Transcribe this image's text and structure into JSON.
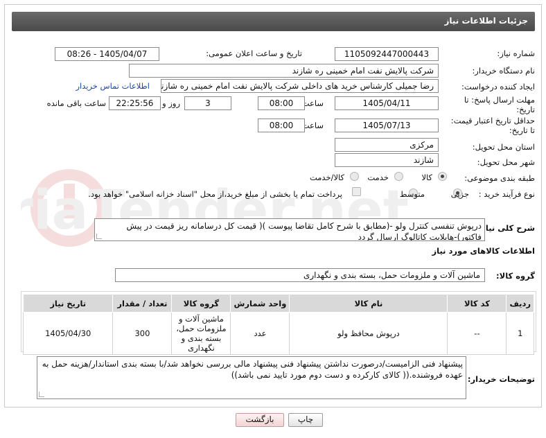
{
  "header": {
    "title": "جزئیات اطلاعات نیاز"
  },
  "watermark": {
    "text": "AriaTender.net"
  },
  "fields": {
    "need_number": {
      "label": "شماره نیاز:",
      "value": "1105092447000443"
    },
    "announce_datetime": {
      "label": "تاریخ و ساعت اعلان عمومی:",
      "value": "1405/04/07 - 08:26"
    },
    "buyer_org": {
      "label": "نام دستگاه خریدار:",
      "value": "شرکت پالایش نفت امام خمینی  ره  شازند"
    },
    "requester": {
      "label": "ایجاد کننده درخواست:",
      "value": "رضا جمیلی کارشناس خرید های داخلی  شرکت پالایش نفت امام خمینی  ره  شازند",
      "contact_link": "اطلاعات تماس خریدار"
    },
    "reply_deadline": {
      "label_line1": "مهلت ارسال پاسخ: تا",
      "label_line2": "تاریخ:",
      "date": "1405/04/11",
      "time_label": "ساعت",
      "time": "08:00",
      "days": "3",
      "days_label": "روز و",
      "remaining": "22:25:56",
      "remaining_label": "ساعت باقی مانده"
    },
    "price_validity": {
      "label_line1": "حداقل تاریخ اعتبار قیمت:",
      "label_line2": "تا تاریخ:",
      "date": "1405/07/13",
      "time_label": "ساعت",
      "time": "08:00"
    },
    "delivery_province": {
      "label": "استان محل تحویل:",
      "value": "مرکزی"
    },
    "delivery_city": {
      "label": "شهر محل تحویل:",
      "value": "شازند"
    },
    "category": {
      "label": "طبقه بندی موضوعی:",
      "options": [
        "کالا",
        "خدمت",
        "کالا/خدمت"
      ],
      "selected": "کالا"
    },
    "purchase_process": {
      "label": "نوع فرآیند خرید :",
      "options": [
        "جزیی",
        "متوسط"
      ],
      "selected": "جزیی",
      "payment_note": "پرداخت تمام یا بخشی از مبلغ خرید،از محل \"اسناد خزانه اسلامی\" خواهد بود."
    },
    "need_summary": {
      "label": "شرح کلی نیاز:",
      "value": "درپوش تنفسی کنترل ولو -(مطابق با شرح کامل تقاضا پیوست )( قیمت کل درسامانه ریز قیمت در پیش فاکتور)-هایلایت کاتالوگ  ارسال گردد"
    }
  },
  "goods_section": {
    "title": "اطلاعات کالاهای مورد نیاز",
    "group_label": "گروه کالا:",
    "group_value": "ماشین آلات و ملزومات حمل، بسته بندی و نگهداری",
    "columns": [
      "ردیف",
      "کد کالا",
      "نام کالا",
      "واحد شمارش",
      "گروه کالا",
      "تعداد / مقدار",
      "تاریخ نیاز"
    ],
    "rows": [
      {
        "row": "1",
        "code": "--",
        "name": "درپوش محافظ ولو",
        "unit": "عدد",
        "group": "ماشین آلات و ملزومات حمل، بسته بندی و نگهداری",
        "qty": "300",
        "date": "1405/04/30"
      }
    ]
  },
  "buyer_notes": {
    "label": "توضیحات خریدار:",
    "value": "پیشنهاد فنی الزامیست/درصورت نداشتن پیشنهاد فنی پیشنهاد مالی بررسی نخواهد شد/با بسته بندی استاندار/هزینه حمل به عهده فروشنده.(( کالای کارکرده و دست دوم مورد تایید نمی باشد))"
  },
  "buttons": {
    "print": "چاپ",
    "back": "بازگشت"
  }
}
